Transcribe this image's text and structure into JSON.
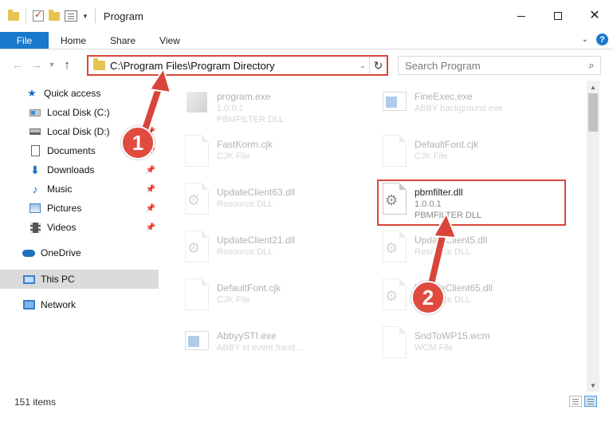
{
  "window": {
    "title": "Program"
  },
  "ribbon": {
    "tabs": [
      "File",
      "Home",
      "Share",
      "View"
    ]
  },
  "address": {
    "path": "C:\\Program Files\\Program Directory"
  },
  "search": {
    "placeholder": "Search Program"
  },
  "sidebar": {
    "items": [
      {
        "label": "Quick access",
        "icon": "star-icon",
        "pinned": false
      },
      {
        "label": "Local Disk (C:)",
        "icon": "disk-icon",
        "pinned": true
      },
      {
        "label": "Local Disk (D:)",
        "icon": "disk-icon",
        "pinned": true
      },
      {
        "label": "Documents",
        "icon": "documents-icon",
        "pinned": true
      },
      {
        "label": "Downloads",
        "icon": "downloads-icon",
        "pinned": true
      },
      {
        "label": "Music",
        "icon": "music-icon",
        "pinned": true
      },
      {
        "label": "Pictures",
        "icon": "pictures-icon",
        "pinned": true
      },
      {
        "label": "Videos",
        "icon": "videos-icon",
        "pinned": true
      },
      {
        "label": "OneDrive",
        "icon": "onedrive-icon",
        "pinned": false
      },
      {
        "label": "This PC",
        "icon": "this-pc-icon",
        "pinned": false,
        "selected": true
      },
      {
        "label": "Network",
        "icon": "network-icon",
        "pinned": false
      }
    ]
  },
  "files": {
    "left": [
      {
        "name": "program.exe",
        "line2": "1.0.0.1",
        "line3": "PBMFILTER DLL",
        "icon": "cube-icon"
      },
      {
        "name": "FastKorm.cjk",
        "line2": "CJK File",
        "icon": "file-icon"
      },
      {
        "name": "UpdateClient63.dll",
        "line2": "Resource DLL",
        "icon": "dll-gear-icon"
      },
      {
        "name": "UpdateClient21.dll",
        "line2": "Resource DLL",
        "icon": "dll-gear-icon"
      },
      {
        "name": "DefaultFont.cjk",
        "line2": "CJK File",
        "icon": "file-icon"
      },
      {
        "name": "AbbyySTI.exe",
        "line2": "ABBY st event hand...",
        "icon": "exe-icon"
      }
    ],
    "right": [
      {
        "name": "FineExec.exe",
        "line2": "ABBY background exe",
        "icon": "exe-icon"
      },
      {
        "name": "DefaultFont.cjk",
        "line2": "CJK File",
        "icon": "file-icon"
      },
      {
        "name": "pbmfilter.dll",
        "line2": "1.0.0.1",
        "line3": "PBMFILTER DLL",
        "icon": "dll-gear-icon",
        "highlighted": true
      },
      {
        "name": "UpdateClient5.dll",
        "line2": "Resource DLL",
        "icon": "dll-gear-icon"
      },
      {
        "name": "UpdateClient65.dll",
        "line2": "Resource DLL",
        "icon": "dll-gear-icon"
      },
      {
        "name": "SndToWP15.wcm",
        "line2": "WCM File",
        "icon": "file-icon"
      }
    ]
  },
  "status": {
    "item_count": "151 items"
  },
  "annotations": {
    "marker1": "1",
    "marker2": "2",
    "color": "#d9453b"
  }
}
